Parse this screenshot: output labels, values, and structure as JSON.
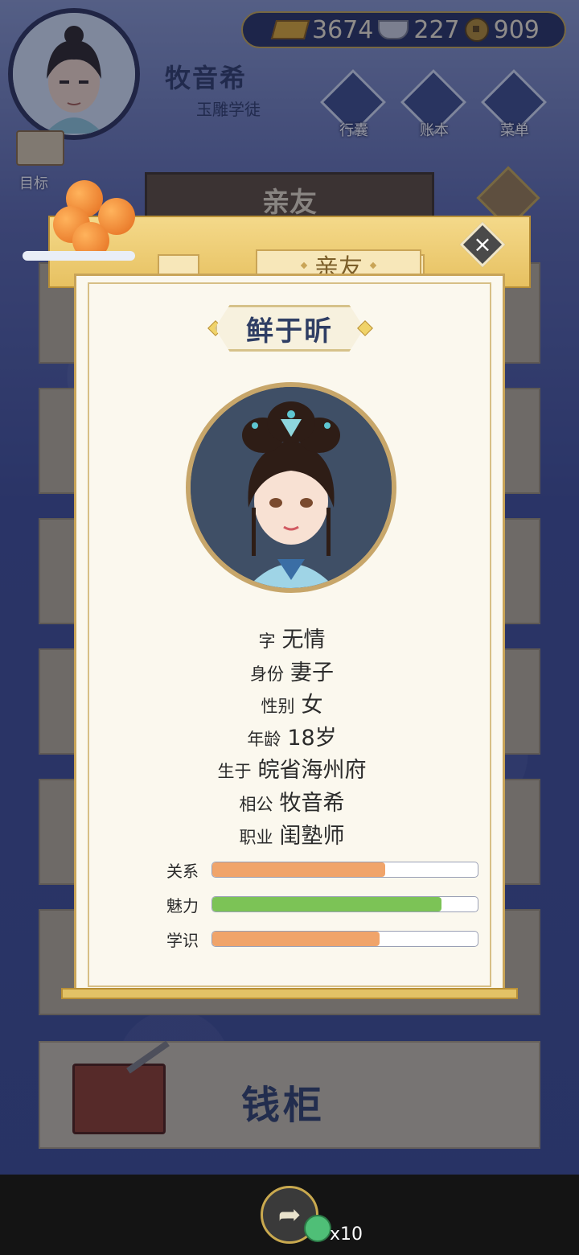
{
  "player": {
    "name": "牧音希",
    "title": "玉雕学徒"
  },
  "currency": {
    "gold": "3674",
    "silver": "227",
    "coins": "909"
  },
  "menu": {
    "bag": "行囊",
    "ledger": "账本",
    "menu": "菜单"
  },
  "target_label": "目标",
  "background_page": {
    "title": "亲友",
    "money_chest": "钱柜"
  },
  "modal": {
    "title": "亲友",
    "character_name": "鲜于昕",
    "info": [
      {
        "key": "字",
        "value": "无情"
      },
      {
        "key": "身份",
        "value": "妻子"
      },
      {
        "key": "性别",
        "value": "女"
      },
      {
        "key": "年龄",
        "value": "18岁"
      },
      {
        "key": "生于",
        "value": "皖省海州府"
      },
      {
        "key": "相公",
        "value": "牧音希"
      },
      {
        "key": "职业",
        "value": "闺塾师"
      }
    ],
    "stats": [
      {
        "label": "关系",
        "value": 0.65,
        "color": "#f0a46a"
      },
      {
        "label": "魅力",
        "value": 0.865,
        "color": "#7cc356"
      },
      {
        "label": "学识",
        "value": 0.63,
        "color": "#f0a46a"
      }
    ]
  },
  "share": {
    "count": "x10"
  }
}
